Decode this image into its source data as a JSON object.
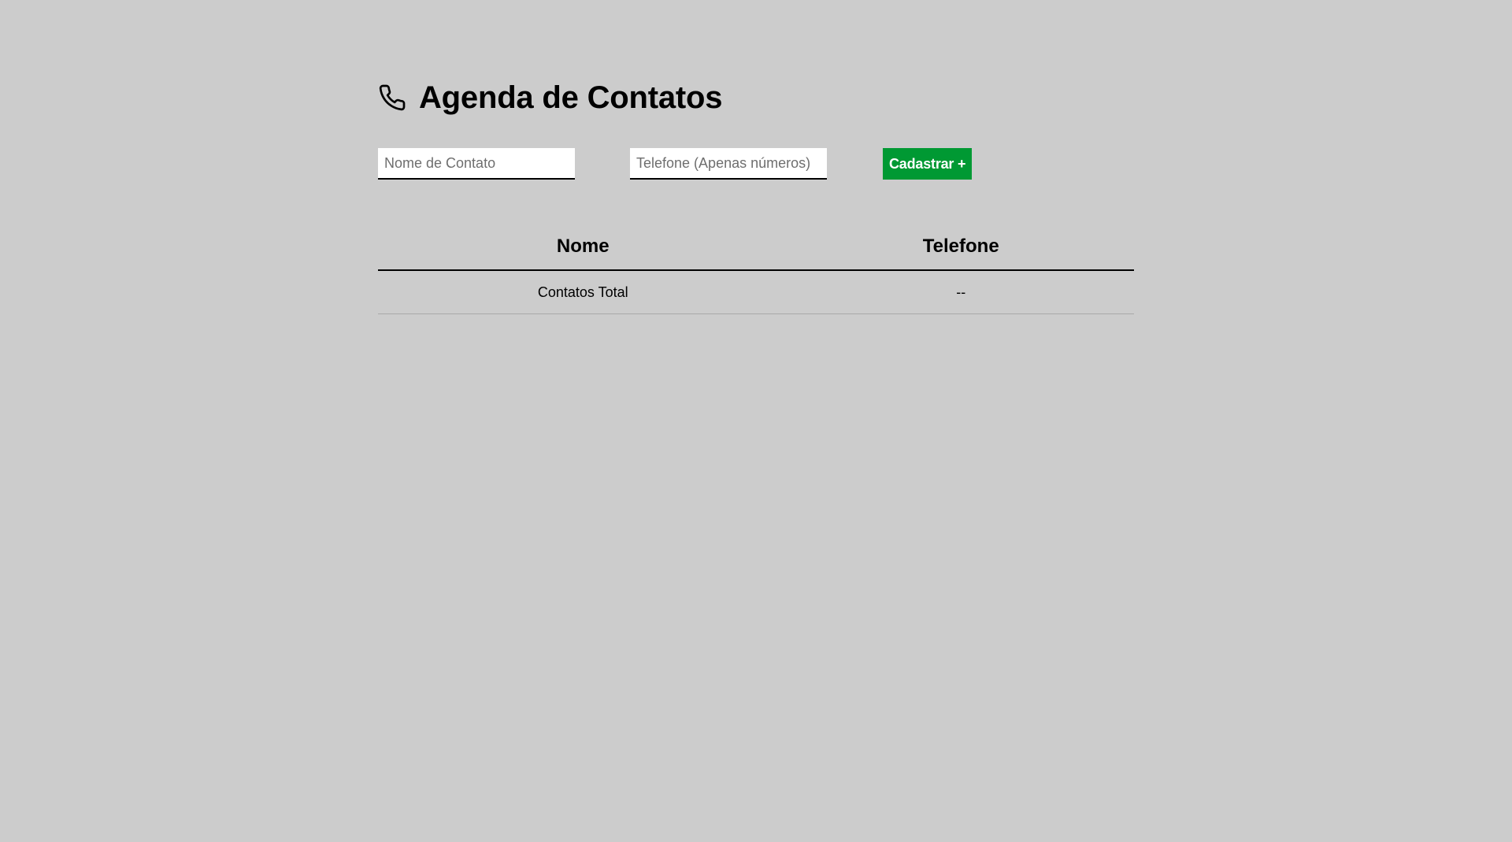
{
  "header": {
    "icon": "phone-icon",
    "title": "Agenda de Contatos"
  },
  "form": {
    "name_input": {
      "value": "",
      "placeholder": "Nome de Contato"
    },
    "phone_input": {
      "value": "",
      "placeholder": "Telefone (Apenas números)"
    },
    "submit_label": "Cadastrar +"
  },
  "table": {
    "columns": [
      "Nome",
      "Telefone"
    ],
    "footer_row": {
      "label": "Contatos Total",
      "value": "--"
    }
  },
  "colors": {
    "background": "#cccccc",
    "accent": "#009933",
    "input_background": "#ffffff"
  }
}
